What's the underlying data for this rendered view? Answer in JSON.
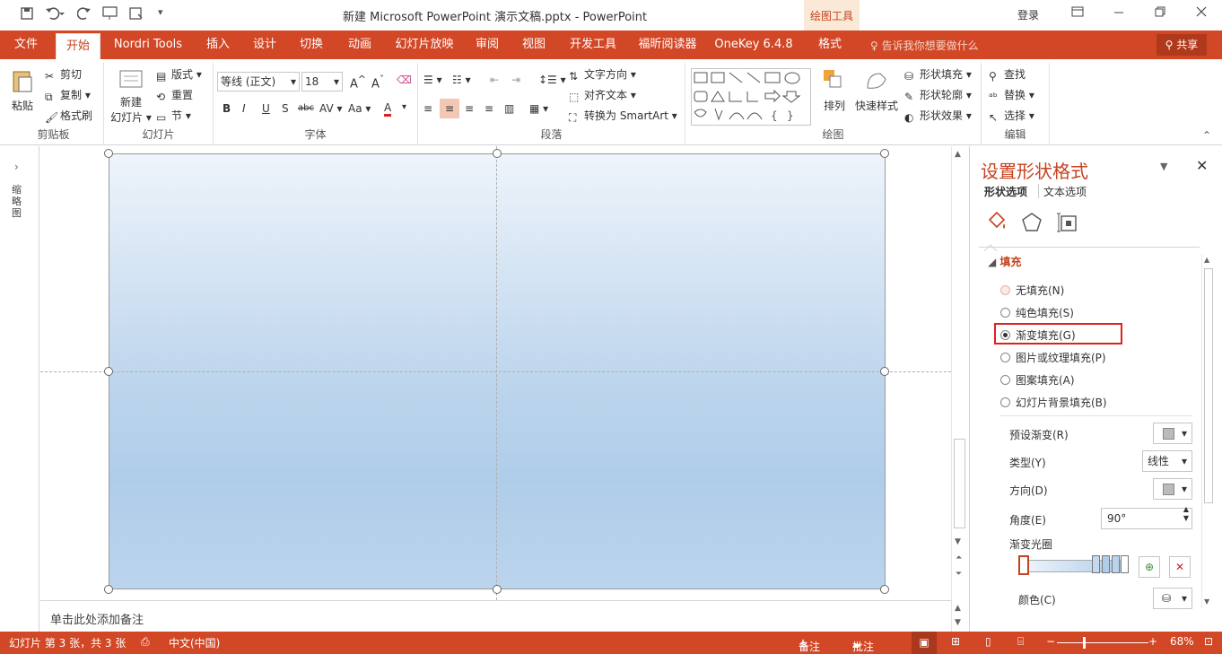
{
  "titlebar": {
    "doc_title": "新建 Microsoft PowerPoint 演示文稿.pptx  -  PowerPoint",
    "context_tools": "绘图工具",
    "login": "登录"
  },
  "tabs": [
    {
      "label": "文件"
    },
    {
      "label": "开始"
    },
    {
      "label": "Nordri Tools"
    },
    {
      "label": "插入"
    },
    {
      "label": "设计"
    },
    {
      "label": "切换"
    },
    {
      "label": "动画"
    },
    {
      "label": "幻灯片放映"
    },
    {
      "label": "审阅"
    },
    {
      "label": "视图"
    },
    {
      "label": "开发工具"
    },
    {
      "label": "福昕阅读器"
    },
    {
      "label": "OneKey 6.4.8"
    },
    {
      "label": "格式"
    }
  ],
  "tellme": "告诉我你想要做什么",
  "share": "共享",
  "ribbon": {
    "clipboard": {
      "paste": "粘贴",
      "cut": "剪切",
      "copy": "复制",
      "format_painter": "格式刷",
      "label": "剪贴板"
    },
    "slides": {
      "new_slide_1": "新建",
      "new_slide_2": "幻灯片",
      "layout": "版式",
      "reset": "重置",
      "section": "节",
      "label": "幻灯片"
    },
    "font": {
      "font_name": "等线 (正文)",
      "font_size": "18",
      "label": "字体"
    },
    "paragraph": {
      "text_direction": "文字方向",
      "align_text": "对齐文本",
      "smartart": "转换为 SmartArt",
      "label": "段落"
    },
    "drawing": {
      "arrange": "排列",
      "quick_styles": "快速样式",
      "shape_fill": "形状填充",
      "shape_outline": "形状轮廓",
      "shape_effects": "形状效果",
      "label": "绘图"
    },
    "editing": {
      "find": "查找",
      "replace": "替换",
      "select": "选择",
      "label": "编辑"
    }
  },
  "leftpane": {
    "label": "缩略图"
  },
  "notes": {
    "placeholder": "单击此处添加备注"
  },
  "format_pane": {
    "title": "设置形状格式",
    "tab_shape": "形状选项",
    "tab_text": "文本选项",
    "section_fill": "填充",
    "fill_options": [
      {
        "label": "无填充(N)",
        "selected": false
      },
      {
        "label": "纯色填充(S)",
        "selected": false
      },
      {
        "label": "渐变填充(G)",
        "selected": true
      },
      {
        "label": "图片或纹理填充(P)",
        "selected": false
      },
      {
        "label": "图案填充(A)",
        "selected": false
      },
      {
        "label": "幻灯片背景填充(B)",
        "selected": false
      }
    ],
    "preset_gradient": "预设渐变(R)",
    "type_label": "类型(Y)",
    "type_value": "线性",
    "direction": "方向(D)",
    "angle_label": "角度(E)",
    "angle_value": "90°",
    "gradient_stops": "渐变光圈",
    "color_label": "颜色(C)"
  },
  "status": {
    "slide_info": "幻灯片 第 3 张，共 3 张",
    "language": "中文(中国)",
    "notes": "备注",
    "comments": "批注",
    "zoom": "68%"
  },
  "colors": {
    "accent": "#d24726",
    "accent_text": "#c5421f",
    "highlight": "#e02020"
  }
}
